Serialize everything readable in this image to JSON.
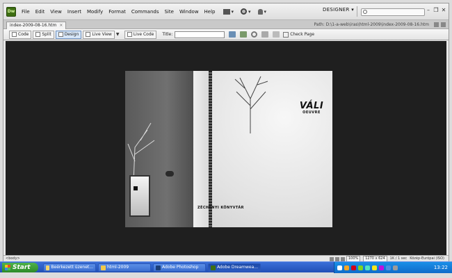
{
  "app": {
    "logo": "Dw"
  },
  "menu": [
    "File",
    "Edit",
    "View",
    "Insert",
    "Modify",
    "Format",
    "Commands",
    "Site",
    "Window",
    "Help"
  ],
  "workspace": {
    "label": "DESIGNER"
  },
  "document": {
    "tab": "index-2009-08-16.htm",
    "path": "Path: D:\\1-a-web\\iras\\html-2009\\index-2009-08-16.htm"
  },
  "toolbar": {
    "code": "Code",
    "split": "Split",
    "design": "Design",
    "live_view": "Live View",
    "live_code": "Live Code",
    "title_label": "Title:",
    "title_value": "",
    "check_page": "Check Page"
  },
  "canvas": {
    "logo_big": "VÁLI",
    "logo_small": "OEUVRE",
    "caption": "ZÉCHENYI KÖNYVTÁR"
  },
  "status": {
    "tag": "<body>",
    "zoom": "100%",
    "size": "1270 x 624",
    "download": "1K / 1 sec",
    "encoding": "Közép-Európai (ISO)"
  },
  "taskbar": {
    "start": "Start",
    "tasks": [
      "Beérkezett üzenet...",
      "html-2009",
      "Adobe Photoshop",
      "Adobe Dreamwea..."
    ],
    "clock": "13:22"
  },
  "colors": {
    "accent_logo": "#3e6e12",
    "taskbar": "#245edb",
    "start": "#3aa035"
  }
}
